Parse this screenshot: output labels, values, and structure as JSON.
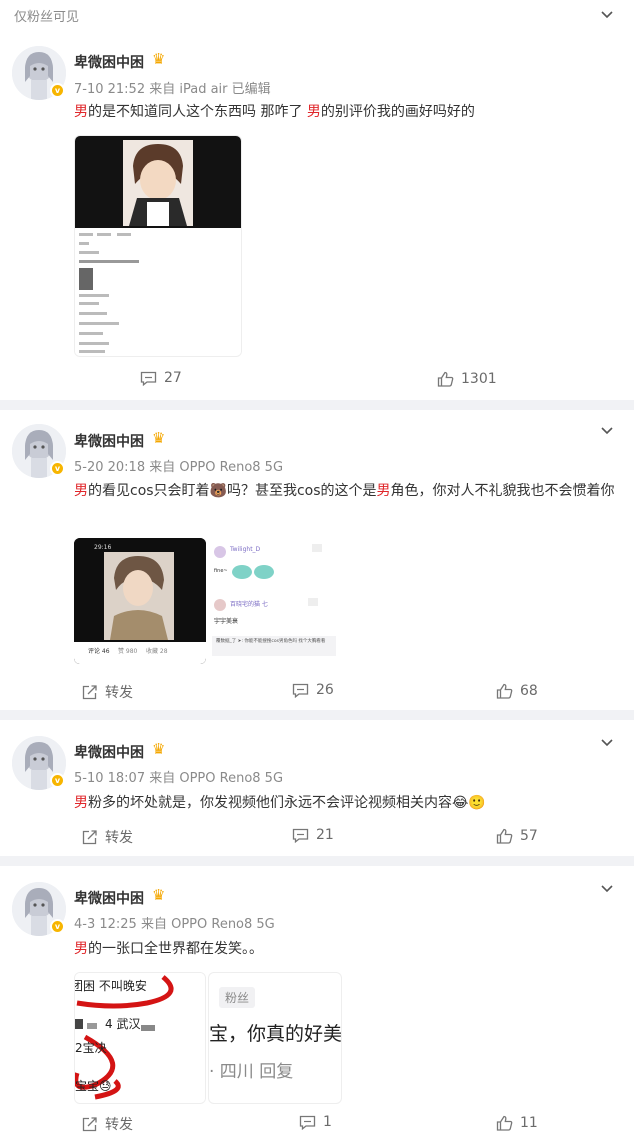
{
  "header": {
    "visibility_label": "仅粉丝可见"
  },
  "user": {
    "name": "卑微困中困"
  },
  "posts": [
    {
      "meta": "7-10 21:52 来自 iPad air 已编辑",
      "segments": [
        {
          "text": "男",
          "hl": true
        },
        {
          "text": "的是不知道同人这个东西吗 那咋了 ",
          "hl": false
        },
        {
          "text": "男",
          "hl": true
        },
        {
          "text": "的别评价我的画好吗好的",
          "hl": false
        }
      ],
      "actions": {
        "comments": "27",
        "likes": "1301"
      }
    },
    {
      "meta": "5-20 20:18 来自 OPPO Reno8 5G",
      "segments": [
        {
          "text": "男",
          "hl": true
        },
        {
          "text": "的看见cos只会盯着🐻吗？甚至我cos的这个是",
          "hl": false
        },
        {
          "text": "男",
          "hl": true
        },
        {
          "text": "角色，你对人不礼貌我也不会惯着你",
          "hl": false
        }
      ],
      "actions": {
        "repost": "转发",
        "comments": "26",
        "likes": "68"
      },
      "img_texts": {
        "status": "29:16 ▮▮▮",
        "tab_comments": "评论 46",
        "tab_likes": "赞 980",
        "tab_fav": "收藏 28",
        "c1_user": "Twilight_D",
        "c1_text": "fine~",
        "c2_user": "百晓宅的猫 七",
        "c2_text": "宇宇美衰",
        "quote": "覆数据_了 ➤: 你能不能搜搜cos男角色吗 找个大胸看看"
      }
    },
    {
      "meta": "5-10 18:07 来自 OPPO Reno8 5G",
      "segments": [
        {
          "text": "男",
          "hl": true
        },
        {
          "text": "粉多的坏处就是，你发视频他们永远不会评论视频相关内容😂🙂",
          "hl": false
        }
      ],
      "actions": {
        "repost": "转发",
        "comments": "21",
        "likes": "57"
      }
    },
    {
      "meta": "4-3 12:25 来自 OPPO Reno8 5G",
      "segments": [
        {
          "text": "男",
          "hl": true
        },
        {
          "text": "的一张口全世界都在发笑。。",
          "hl": false
        }
      ],
      "actions": {
        "repost": "转发",
        "comments": "1",
        "likes": "11"
      },
      "img_texts": {
        "a_line1": "团困 不叫晚安",
        "a_line2": "4 武汉  ",
        "a_line3": "2宝决",
        "a_line4": "宝宝😓",
        "b_tag": "粉丝",
        "b_line1": "宝，你真的好美",
        "b_line2": "· 四川   回复"
      }
    }
  ],
  "colors": {
    "highlight": "#e0262a",
    "meta": "#8a8a8a",
    "separator": "#f1f2f5"
  }
}
